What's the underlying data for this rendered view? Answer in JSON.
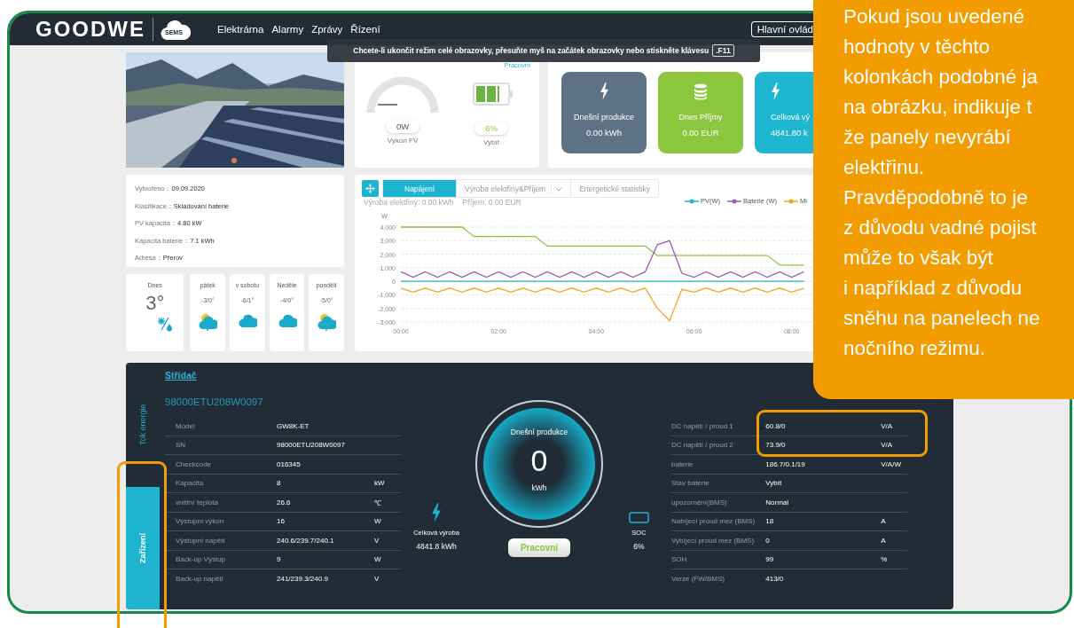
{
  "header": {
    "logo": "GOODWE",
    "badge": "SEMS",
    "nav": [
      {
        "label": "Elektrárna"
      },
      {
        "label": "Alarmy"
      },
      {
        "label": "Zprávy"
      },
      {
        "label": "Řízení"
      }
    ],
    "dashboard_button": "Hlavní ovlád"
  },
  "fullscreen_notice": {
    "text": "Chcete-li ukončit režim celé obrazovky, přesuňte myš na začátek obrazovky nebo stiskněte klávesu",
    "key": ".F11"
  },
  "status_card": {
    "status": "Pracovní",
    "pv_power": "0W",
    "pv_label": "Výkon FV",
    "battery": {
      "level": 0.75,
      "reading": "6%",
      "label": "Vybít"
    }
  },
  "stat_cards": [
    {
      "title": "Dnešní produkce",
      "value": "0.00 kWh",
      "color": "#5d7385",
      "kind": "bolt"
    },
    {
      "title": "Dnes Příjmy",
      "value": "0.00 EUR",
      "color": "#8cc63f",
      "kind": "coins"
    },
    {
      "title": "Celková vý",
      "value": "4841.80 k",
      "color": "#1eb6d0",
      "kind": "bolt"
    }
  ],
  "plant_info": [
    {
      "label": "Vytvořeno：",
      "value": "09.09.2020"
    },
    {
      "label": "Klasifikace：",
      "value": "Skladování baterie"
    },
    {
      "label": "PV kapacita：",
      "value": "4.80 kW"
    },
    {
      "label": "Kapacita baterie：",
      "value": "7.1 kWh"
    },
    {
      "label": "Adresa：",
      "value": "Přerov"
    }
  ],
  "weather": [
    {
      "day": "Dnes",
      "temp": "3°",
      "kind": "snow-rain"
    },
    {
      "day": "pátek",
      "temp": "-3/0°",
      "kind": "sun-cloud"
    },
    {
      "day": "v sobotu",
      "temp": "-6/1°",
      "kind": "cloud"
    },
    {
      "day": "Neděle",
      "temp": "-4/0°",
      "kind": "cloud"
    },
    {
      "day": "pondělí",
      "temp": "-5/0°",
      "kind": "sun-cloud"
    }
  ],
  "power_chart": {
    "tabs": [
      {
        "label": "Napájení",
        "selected": true,
        "dropdown": false
      },
      {
        "label": "Výroba elektřiny&Příjem",
        "selected": false,
        "dropdown": true
      },
      {
        "label": "Energetické statistiky",
        "selected": false,
        "dropdown": false
      }
    ],
    "summary": [
      {
        "label": "Výroba elektřiny:",
        "value": "0.00 kWh"
      },
      {
        "label": "Příjem:",
        "value": "0.00 EUR"
      }
    ],
    "chart_data": {
      "type": "line",
      "ylabel": "W",
      "x": [
        0,
        0.25,
        0.5,
        0.75,
        1,
        1.25,
        1.5,
        1.75,
        2,
        2.25,
        2.5,
        2.75,
        3,
        3.25,
        3.5,
        3.75,
        4,
        4.25,
        4.5,
        4.75,
        5,
        5.25,
        5.5,
        5.75,
        6,
        6.25,
        6.5,
        6.75,
        7,
        7.25,
        7.5,
        7.75,
        8,
        8.25
      ],
      "xlim": [
        0,
        11
      ],
      "ylim": [
        -3000,
        4000
      ],
      "grid": true,
      "yticks": [
        {
          "value": 4000,
          "label": "4,000"
        },
        {
          "value": 3000,
          "label": "3,000"
        },
        {
          "value": 2000,
          "label": "2,000"
        },
        {
          "value": 1000,
          "label": "1,000"
        },
        {
          "value": 0,
          "label": "0"
        },
        {
          "value": -1000,
          "label": "-1,000"
        },
        {
          "value": -2000,
          "label": "-2,000"
        },
        {
          "value": -3000,
          "label": "-3,000"
        }
      ],
      "xticks": [
        {
          "value": 0,
          "label": "00:00"
        },
        {
          "value": 2,
          "label": "02:00"
        },
        {
          "value": 4,
          "label": "04:00"
        },
        {
          "value": 6,
          "label": "06:00"
        },
        {
          "value": 8,
          "label": "08:00"
        }
      ],
      "series": [
        {
          "color": "#8cc63f",
          "values": [
            4000,
            4000,
            4000,
            4000,
            4000,
            4000,
            3300,
            3300,
            3300,
            3300,
            3300,
            3300,
            2600,
            2600,
            2600,
            2600,
            2600,
            2600,
            2600,
            2600,
            2600,
            1900,
            1900,
            1900,
            1900,
            1900,
            1900,
            1900,
            1900,
            1900,
            1900,
            1200,
            1200,
            1200
          ]
        },
        {
          "name": "PV(W)",
          "color": "#1fb3c8",
          "values": [
            0,
            0,
            0,
            0,
            0,
            0,
            0,
            0,
            0,
            0,
            0,
            0,
            0,
            0,
            0,
            0,
            0,
            0,
            0,
            0,
            0,
            0,
            0,
            0,
            0,
            0,
            0,
            0,
            0,
            0,
            0,
            0,
            0,
            0
          ]
        },
        {
          "name": "Baterie (W)",
          "color": "#9b59b6",
          "values": [
            700,
            300,
            700,
            300,
            700,
            300,
            700,
            300,
            700,
            300,
            700,
            300,
            700,
            300,
            700,
            300,
            700,
            300,
            700,
            300,
            700,
            2700,
            3000,
            600,
            300,
            700,
            300,
            700,
            300,
            700,
            300,
            700,
            300,
            700
          ]
        },
        {
          "name": "Mi",
          "color": "#f5a623",
          "values": [
            -500,
            -800,
            -500,
            -800,
            -500,
            -800,
            -500,
            -800,
            -500,
            -800,
            -500,
            -800,
            -500,
            -800,
            -500,
            -800,
            -500,
            -800,
            -500,
            -800,
            -500,
            -2000,
            -2900,
            -600,
            -800,
            -500,
            -800,
            -500,
            -800,
            -500,
            -800,
            -500,
            -800,
            -500
          ]
        }
      ]
    }
  },
  "device_panel": {
    "side_tabs": [
      {
        "label": "Tok energie",
        "selected": false
      },
      {
        "label": "Zařízení",
        "selected": true
      }
    ],
    "title": "Střídač",
    "serial": "98000ETU208W0097",
    "inverter_rows": [
      {
        "label": "Model",
        "value": "GW8K-ET"
      },
      {
        "label": "SN",
        "value": "98000ETU208W0097"
      },
      {
        "label": "Checkcode",
        "value": "016345"
      },
      {
        "label": "Kapacita",
        "value": "8",
        "unit": "kW"
      },
      {
        "label": "vnitřní teplota",
        "value": "26.6",
        "unit": "℃"
      },
      {
        "label": "Výstupní výkon",
        "value": "16",
        "unit": "W"
      },
      {
        "label": "Výstupní napětí",
        "value": "240.6/239.7/240.1",
        "unit": "V"
      },
      {
        "label": "Back-up Výstup",
        "value": "9",
        "unit": "W"
      },
      {
        "label": "Back-up napětí",
        "value": "241/239.3/240.9",
        "unit": "V"
      }
    ],
    "total": {
      "label": "Celková výroba",
      "value": "4841.8 kWh"
    },
    "today": {
      "label": "Dnešní produkce",
      "value": "0",
      "unit": "kWh"
    },
    "status": "Pracovní",
    "soc": {
      "label": "SOC",
      "value": "6%"
    },
    "battery_rows": [
      {
        "label": "DC napětí / proud 1",
        "value": "60.8/0",
        "unit": "V/A"
      },
      {
        "label": "DC napětí / proud 2",
        "value": "73.9/0",
        "unit": "V/A"
      },
      {
        "label": "baterie",
        "value": "186.7/0.1/19",
        "unit": "V/A/W"
      },
      {
        "label": "Stav baterie",
        "value": "Vybít"
      },
      {
        "label": "upozornění(BMS)",
        "value": "Normal"
      },
      {
        "label": "Nabíjecí proud mez (BMS)",
        "value": "18",
        "unit": "A"
      },
      {
        "label": "Vybíjecí proud mez (BMS)",
        "value": "0",
        "unit": "A"
      },
      {
        "label": "SOH",
        "value": "99",
        "unit": "%"
      },
      {
        "label": "Verze (FW/BMS)",
        "value": "413/0"
      }
    ]
  },
  "callout": {
    "lines": [
      "Pokud jsou uvedené",
      "hodnoty v těchto",
      "kolonkách podobné ja",
      "na obrázku, indikuje t",
      "že panely nevyrábí",
      "elektřinu.",
      "Pravděpodobně to je",
      "z důvodu vadné pojist",
      "může to však být",
      "i například z důvodu",
      "sněhu na panelech ne",
      "nočního režimu."
    ]
  }
}
